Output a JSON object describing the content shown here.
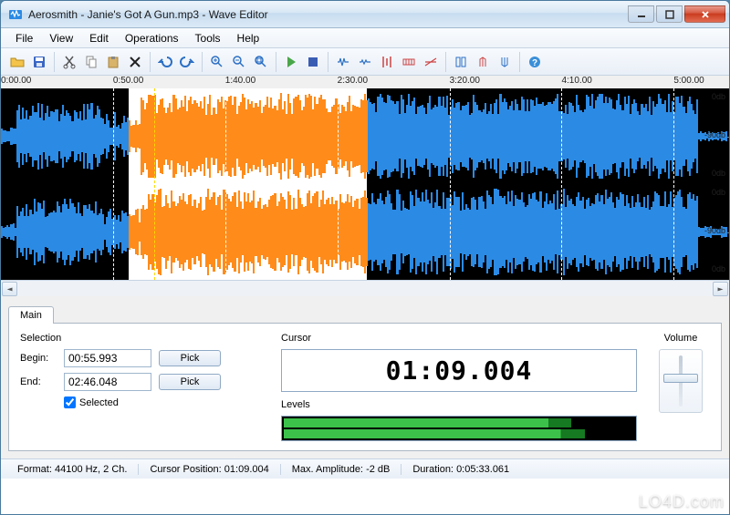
{
  "title": "Aerosmith - Janie's Got A Gun.mp3 - Wave Editor",
  "menus": [
    "File",
    "View",
    "Edit",
    "Operations",
    "Tools",
    "Help"
  ],
  "ruler_ticks": [
    "0:00.00",
    "0:50.00",
    "1:40.00",
    "2:30.00",
    "3:20.00",
    "4:10.00",
    "5:00.00"
  ],
  "db_labels": [
    "0db",
    "-90db",
    "0db",
    "0db",
    "-90db",
    "0db"
  ],
  "tab_label": "Main",
  "selection": {
    "title": "Selection",
    "begin_label": "Begin:",
    "begin_value": "00:55.993",
    "end_label": "End:",
    "end_value": "02:46.048",
    "pick_label": "Pick",
    "selected_label": "Selected",
    "selected_checked": true
  },
  "cursor": {
    "title": "Cursor",
    "value": "01:09.004",
    "levels_title": "Levels",
    "level_left_pct": 82,
    "level_right_pct": 86
  },
  "volume": {
    "title": "Volume",
    "position_pct": 35
  },
  "status": {
    "format_label": "Format:",
    "format_value": "44100 Hz, 2 Ch.",
    "cursor_label": "Cursor Position:",
    "cursor_value": "01:09.004",
    "amp_label": "Max. Amplitude:",
    "amp_value": "-2 dB",
    "dur_label": "Duration:",
    "dur_value": "0:05:33.061"
  },
  "waveform": {
    "selection_start_pct": 17.5,
    "selection_end_pct": 50.3,
    "cursor_pct": 21.0
  },
  "watermark": "LO4D.com"
}
